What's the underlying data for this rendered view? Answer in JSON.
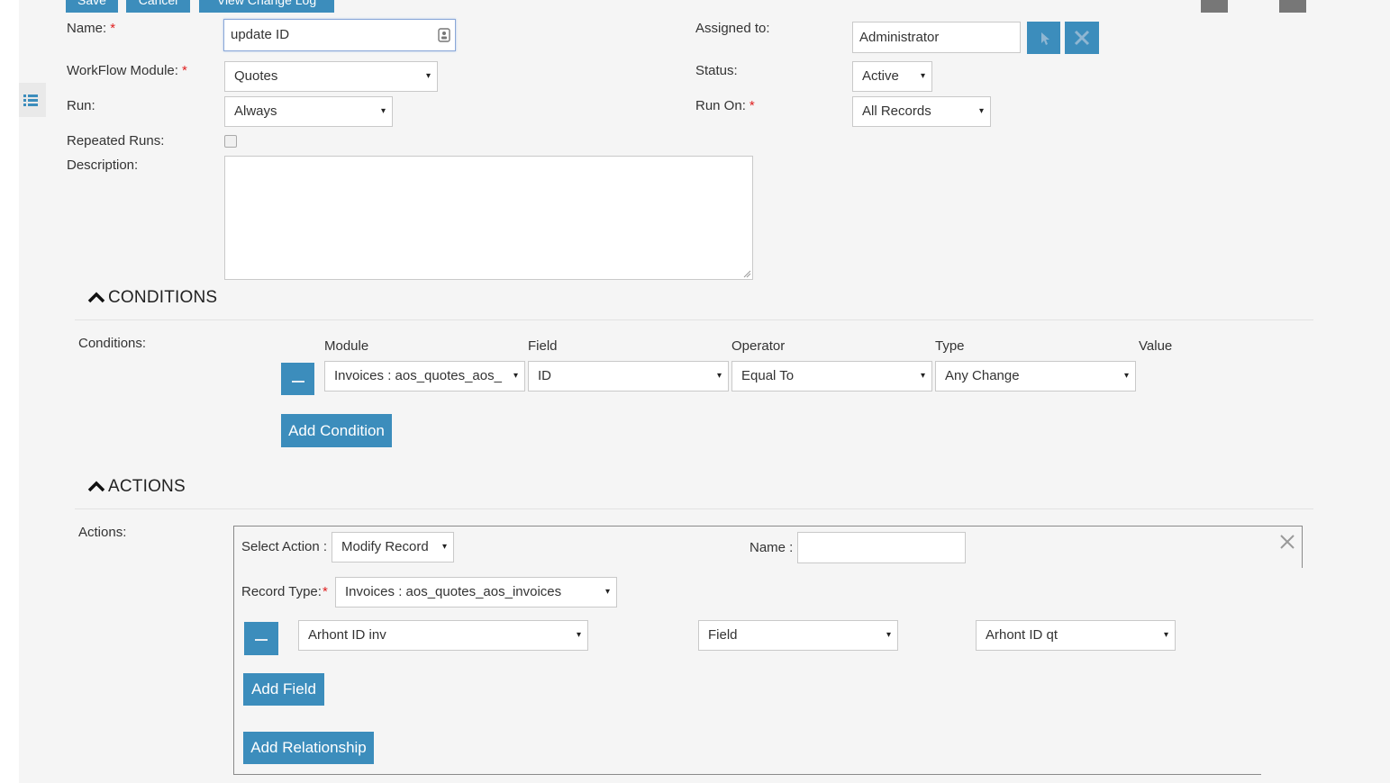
{
  "toolbar": {
    "save_label": "Save",
    "cancel_label": "Cancel",
    "changelog_label": "View Change Log"
  },
  "form": {
    "name_label": "Name:",
    "name_value": "update ID",
    "module_label": "WorkFlow Module:",
    "module_value": "Quotes",
    "run_label": "Run:",
    "run_value": "Always",
    "repeated_label": "Repeated Runs:",
    "description_label": "Description:",
    "assigned_label": "Assigned to:",
    "assigned_value": "Administrator",
    "status_label": "Status:",
    "status_value": "Active",
    "runon_label": "Run On:",
    "runon_value": "All Records",
    "required_mark": "*"
  },
  "conditions": {
    "section_title": "CONDITIONS",
    "label": "Conditions:",
    "headers": {
      "module": "Module",
      "field": "Field",
      "operator": "Operator",
      "type": "Type",
      "value": "Value"
    },
    "rows": [
      {
        "module": "Invoices : aos_quotes_aos_",
        "field": "ID",
        "operator": "Equal To",
        "type": "Any Change"
      }
    ],
    "add_label": "Add Condition"
  },
  "actions": {
    "section_title": "ACTIONS",
    "label": "Actions:",
    "select_action_label": "Select Action :",
    "select_action_value": "Modify Record",
    "name_label": "Name :",
    "record_type_label": "Record Type:",
    "record_type_value": "Invoices : aos_quotes_aos_invoices",
    "field_row": {
      "target": "Arhont ID inv",
      "kind": "Field",
      "source": "Arhont ID qt"
    },
    "add_field_label": "Add Field",
    "add_relationship_label": "Add Relationship",
    "close_glyph": "✕"
  },
  "icons": {
    "nav_toggle": "list-icon",
    "contact_card": "contact-card-icon",
    "select_user": "cursor-arrow-icon",
    "clear_user": "close-icon",
    "collapse": "chevron-up-icon",
    "remove_row": "minus-icon",
    "dropdown_arrow": "▾"
  },
  "colors": {
    "accent": "#3c8dbc",
    "required": "#e02020",
    "background": "#f5f5f5"
  }
}
